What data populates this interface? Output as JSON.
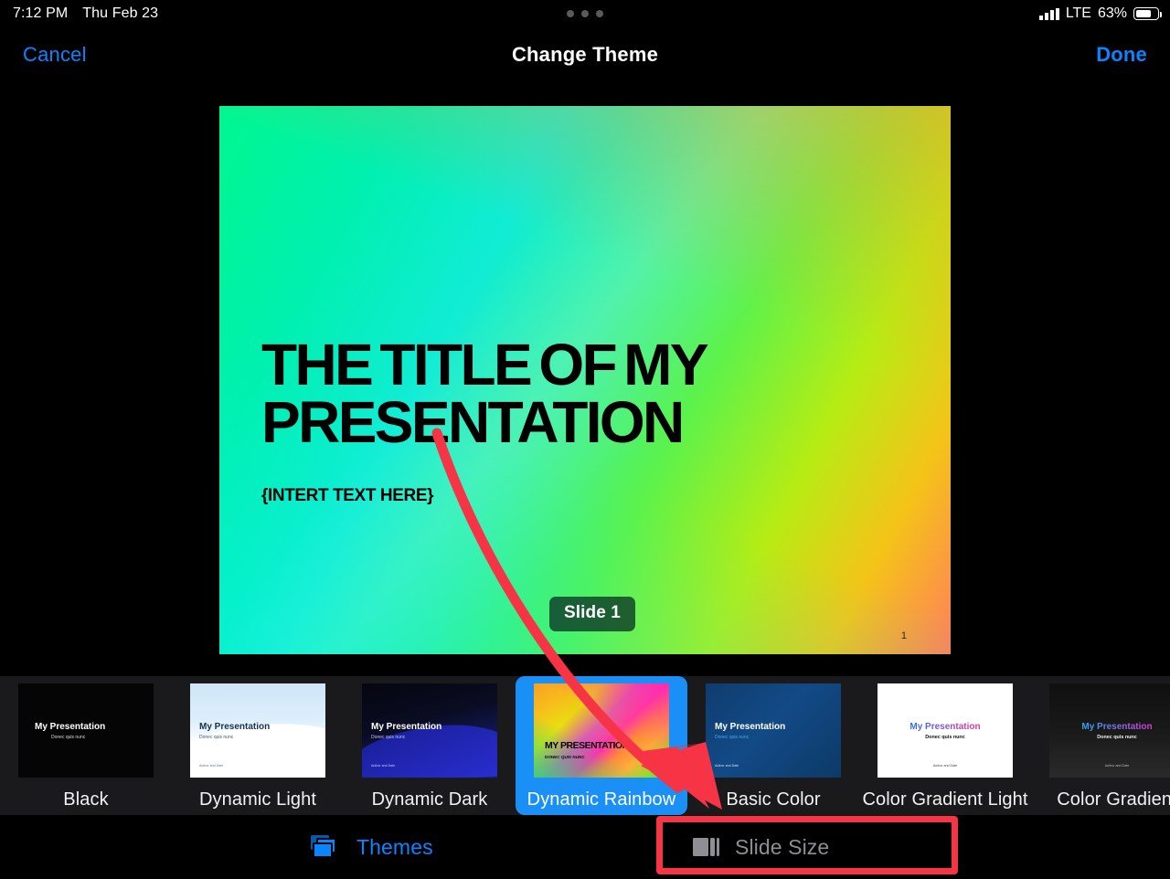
{
  "status_bar": {
    "time": "7:12 PM",
    "date": "Thu Feb 23",
    "carrier": "LTE",
    "battery_percent": "63%",
    "multitask_handle": "three-dots"
  },
  "nav_bar": {
    "cancel_label": "Cancel",
    "title": "Change Theme",
    "done_label": "Done"
  },
  "slide_preview": {
    "title": "THE TITLE OF MY PRESENTATION",
    "subtitle": "{INTERT TEXT HERE}",
    "badge": "Slide 1",
    "page_number": "1",
    "gradient": {
      "top_left": "#00F78F",
      "top_right": "#FF7F5C",
      "bottom_left": "#00F0E0",
      "bottom_right": "#A8E800"
    }
  },
  "theme_picker": {
    "selected": "Dynamic Rainbow",
    "selection_color": "#1A8FF5",
    "themes": [
      {
        "label": "Black",
        "title": "My Presentation",
        "subtitle": "Donec quis nunc",
        "footer": ""
      },
      {
        "label": "Dynamic Light",
        "title": "My Presentation",
        "subtitle": "Donec quis nunc",
        "footer": "Author and Date"
      },
      {
        "label": "Dynamic Dark",
        "title": "My Presentation",
        "subtitle": "Donec quis nunc",
        "footer": "Author and Date"
      },
      {
        "label": "Dynamic Rainbow",
        "title": "MY PRESENTATION",
        "subtitle": "DONEC QUIS NUNC",
        "footer": ""
      },
      {
        "label": "Basic Color",
        "title": "My Presentation",
        "subtitle": "Donec quis nunc",
        "footer": "Author and Date"
      },
      {
        "label": "Color Gradient Light",
        "title": "My Presentation",
        "subtitle": "Donec quis nunc",
        "footer": "Author and Date"
      },
      {
        "label": "Color Gradient",
        "title": "My Presentation",
        "subtitle": "Donec quis nunc",
        "footer": "Author and Date"
      }
    ]
  },
  "toolbar": {
    "themes_label": "Themes",
    "themes_icon": "slides-stack-icon",
    "slide_size_label": "Slide Size",
    "slide_size_icon": "slide-size-icon"
  },
  "annotations": {
    "highlight_color": "#F73446",
    "arrow": "curved-arrow-pointing-to-slide-size",
    "box_target": "Slide Size"
  }
}
